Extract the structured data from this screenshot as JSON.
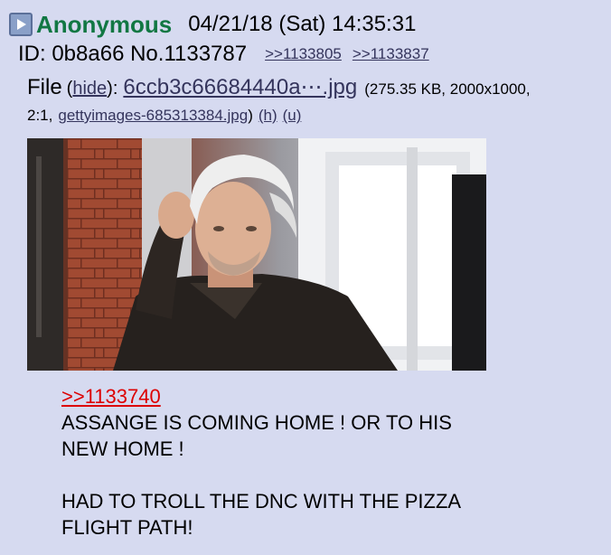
{
  "post": {
    "name": "Anonymous",
    "datetime": "04/21/18 (Sat) 14:35:31",
    "id_label": "ID: 0b8a66 No.1133787",
    "backlinks": [
      ">>1133805",
      ">>1133837"
    ],
    "file": {
      "label": "File",
      "open_paren": "(",
      "hide_label": "hide",
      "close_paren": "):",
      "filename": "6ccb3c66684440a⋯.jpg",
      "meta_line1": "(275.35 KB, 2000x1000,",
      "meta_line2_prefix": "2:1,",
      "original_name": "gettyimages-685313384.jpg",
      "original_close": ")",
      "h_link": "(h)",
      "u_link": "(u)"
    },
    "message": {
      "quote": ">>1133740",
      "lines": [
        "ASSANGE IS COMING HOME ! OR TO HIS",
        "NEW HOME !",
        "",
        "HAD TO TROLL THE DNC WITH THE PIZZA",
        "FLIGHT PATH!"
      ]
    }
  },
  "colors": {
    "background": "#d6daf0",
    "name": "#117743",
    "link": "#34345c",
    "quotelink": "#dd0000"
  },
  "icons": {
    "toggle": "play-arrow-icon"
  }
}
